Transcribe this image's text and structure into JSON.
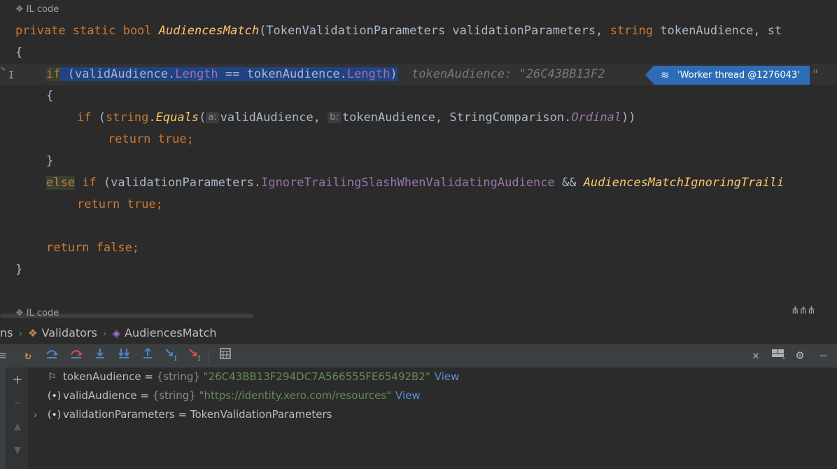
{
  "editor": {
    "il_label_top": "IL code",
    "il_label_bottom": "IL code",
    "signature": {
      "kw_private": "private",
      "kw_static": "static",
      "kw_bool": "bool",
      "method": "AudiencesMatch",
      "params": "(TokenValidationParameters validationParameters, ",
      "kw_string": "string",
      "rest": " tokenAudience, st"
    },
    "brace_open": "{",
    "line_if": {
      "kw": "if",
      "p1": " (validAudience.",
      "prop1": "Length",
      "mid": " == tokenAudience.",
      "prop2": "Length",
      "close": ")",
      "hint": "tokenAudience: \"26C43BB13F2"
    },
    "thread_badge": "'Worker thread @1276043'",
    "thread_trail": "\"",
    "inner_open": "{",
    "line_equals": {
      "kw": "if",
      "open": " (",
      "kw_string": "string",
      "dot": ".",
      "fn": "Equals",
      "paren": "(",
      "hint_a": "a:",
      "arg1": "validAudience,",
      "hint_b": "b:",
      "arg2": "tokenAudience, StringComparison.",
      "ordinal": "Ordinal",
      "close": "))"
    },
    "line_return_true1": {
      "kw_return": "return",
      "kw_true": "true",
      "semi": ";"
    },
    "inner_close": "}",
    "line_else": {
      "kw_else": "else",
      "kw_if": "if",
      "p": " (validationParameters.",
      "prop": "IgnoreTrailingSlashWhenValidatingAudience",
      "and": " && ",
      "fn": "AudiencesMatchIgnoringTraili"
    },
    "line_return_true2": {
      "kw_return": "return",
      "kw_true": "true",
      "semi": ";"
    },
    "line_return_false": {
      "kw_return": "return",
      "kw_false": "false",
      "semi": ";"
    },
    "brace_close": "}"
  },
  "breadcrumb": {
    "items": [
      "ns",
      "Validators",
      "AudiencesMatch"
    ]
  },
  "variables": [
    {
      "name": "tokenAudience",
      "eq": " = ",
      "type": "{string}",
      "value": "\"26C43BB13F294DC7A566555FE65492B2\"",
      "view": "View"
    },
    {
      "name": "validAudience",
      "eq": " = ",
      "type": "{string}",
      "value": "\"https://identity.xero.com/resources\"",
      "view": "View"
    },
    {
      "name": "validationParameters",
      "eq": " = ",
      "value": "TokenValidationParameters"
    }
  ],
  "colors": {
    "background": "#2b2b2b",
    "keyword": "#cc7832",
    "method": "#ffc66d",
    "property": "#9876aa",
    "string": "#6a8759",
    "selection": "#214283",
    "thread_badge": "#2d6db5"
  }
}
